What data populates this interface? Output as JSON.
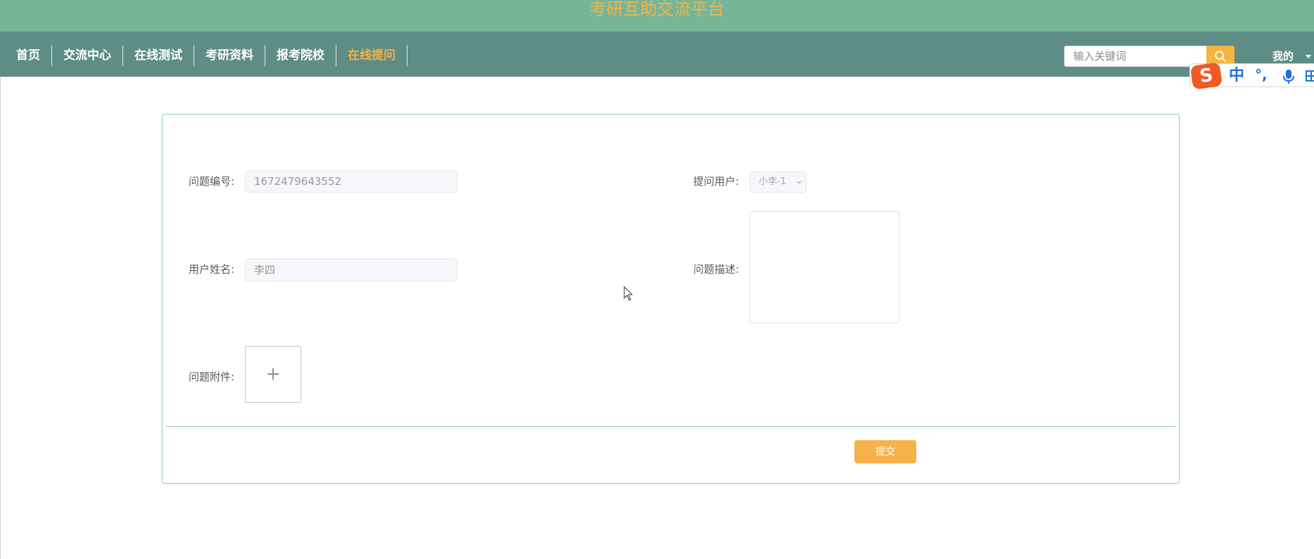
{
  "header": {
    "site_title": "考研互助交流平台",
    "accent_color": "#f5b342",
    "title_bar_color": "#76b698",
    "nav_bar_color": "#5e8d86"
  },
  "nav": {
    "items": [
      {
        "label": "首页",
        "active": false
      },
      {
        "label": "交流中心",
        "active": false
      },
      {
        "label": "在线测试",
        "active": false
      },
      {
        "label": "考研资料",
        "active": false
      },
      {
        "label": "报考院校",
        "active": false
      },
      {
        "label": "在线提问",
        "active": true
      }
    ]
  },
  "search": {
    "placeholder": "输入关键词",
    "icon": "search-icon"
  },
  "user_menu": {
    "label": "我的",
    "icon": "caret-down-icon"
  },
  "ime_toolbar": {
    "logo": "S",
    "mode": "中",
    "punct": "°,",
    "icons": [
      "sogou-logo-icon",
      "microphone-icon",
      "keyboard-grid-icon"
    ]
  },
  "form": {
    "question_no": {
      "label": "问题编号:",
      "value": "1672479643552"
    },
    "asker": {
      "label": "提问用户:",
      "value": "小李-1",
      "icon": "chevron-down-icon"
    },
    "user_name": {
      "label": "用户姓名:",
      "value": "李四"
    },
    "description": {
      "label": "问题描述:",
      "value": ""
    },
    "attachment": {
      "label": "问题附件:",
      "upload_symbol": "+"
    },
    "submit_label": "提交"
  }
}
